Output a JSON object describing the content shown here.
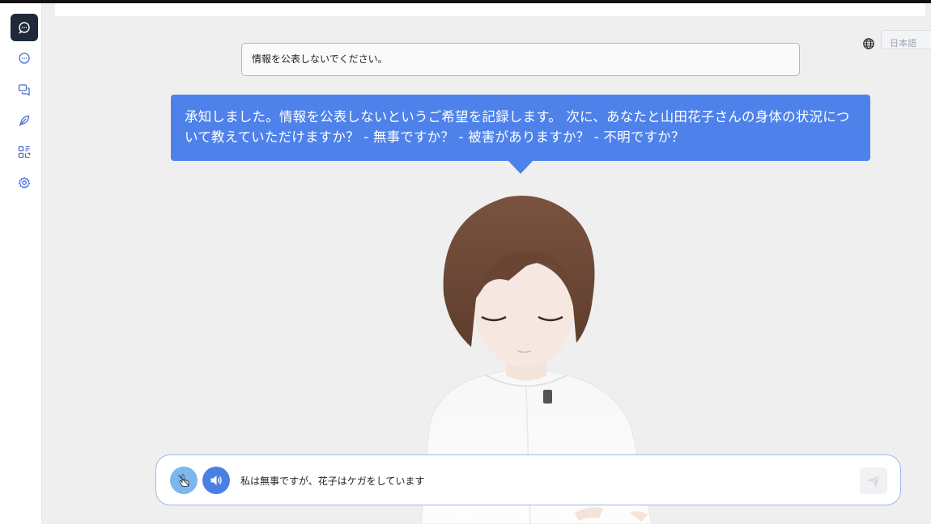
{
  "sidebar": {
    "items": [
      {
        "name": "chat-icon",
        "active": true
      },
      {
        "name": "message-icon",
        "active": false
      },
      {
        "name": "conversations-icon",
        "active": false
      },
      {
        "name": "feather-icon",
        "active": false
      },
      {
        "name": "qr-code-icon",
        "active": false
      },
      {
        "name": "gear-icon",
        "active": false
      }
    ]
  },
  "header": {
    "language_label": "日本語",
    "globe_icon": "globe-icon"
  },
  "chat": {
    "user_message": "情報を公表しないでください。",
    "assistant_message": "承知しました。情報を公表しないというご希望を記録します。 次に、あなたと山田花子さんの身体の状況について教えていただけますか？ - 無事ですか？ - 被害がありますか？ - 不明ですか？"
  },
  "input": {
    "value": "私は無事ですが、花子はケガをしています"
  },
  "colors": {
    "accent": "#4e82ea",
    "sidebar_active": "#1f2937",
    "mic_button": "#7cb8ee",
    "speaker_button": "#4a7fe6",
    "input_border": "#9fb9ec"
  }
}
